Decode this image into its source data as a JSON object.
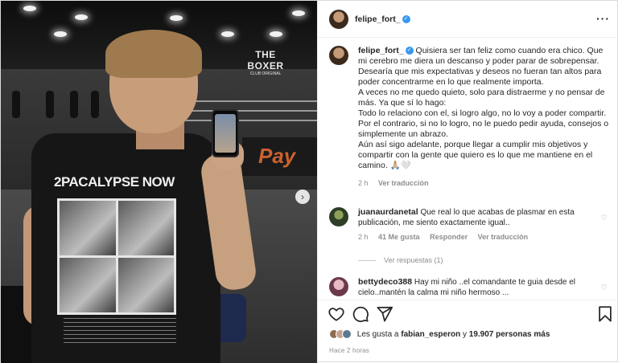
{
  "post": {
    "username": "felipe_fort_",
    "verified_mark": "✓",
    "more_icon": "more-horizontal-icon"
  },
  "photo": {
    "brand_line1": "THE BOXER",
    "brand_line2": "CLUB ORIGINAL",
    "banner_text": "Pay",
    "shirt_title": "2PACALYPSE NOW",
    "next_icon": "chevron-right-icon"
  },
  "caption": {
    "username": "felipe_fort_",
    "paragraphs": [
      "Quisiera ser tan feliz como cuando era chico. Que mi cerebro me diera un descanso y poder parar de sobrepensar.",
      "Desearía que mis expectativas y deseos no fueran tan altos para poder concentrarme en lo que realmente importa.",
      "A veces no me quedo quieto, solo para distraerme y no pensar de más. Ya que sí lo hago:",
      "Todo lo relaciono con el, si logro algo, no lo voy a poder compartir. Por el contrario, si no lo logro, no le puedo pedir ayuda, consejos o simplemente un abrazo.",
      "Aún así sigo adelante, porque llegar a cumplir mis objetivos y compartir con la gente que quiero es lo que me mantiene en el camino. 🙏🏼🤍"
    ],
    "time": "2 h",
    "translation": "Ver traducción"
  },
  "comments": [
    {
      "username": "juanaurdanetal",
      "text": "Que real lo que acabas de plasmar en esta publicación, me siento exactamente igual..",
      "time": "2 h",
      "likes": "41 Me gusta",
      "reply": "Responder",
      "translation": "Ver traducción",
      "view_replies": "Ver respuestas (1)"
    },
    {
      "username": "bettydeco388",
      "text": "Hay mi niño ..el comandante te guia desde el cielo..mantén la calma mi niño hermoso ..."
    }
  ],
  "actions": {
    "like_icon": "heart-icon",
    "comment_icon": "comment-icon",
    "share_icon": "send-icon",
    "save_icon": "bookmark-icon"
  },
  "likes": {
    "prefix": "Les gusta a",
    "first_user": "fabian_esperon",
    "connector": "y",
    "others": "19.907 personas más"
  },
  "time_ago": "Hace 2 horas",
  "colors": {
    "verified_blue": "#3897f0",
    "text_primary": "#262626",
    "text_secondary": "#8e8e8e",
    "border": "#dbdbdb"
  }
}
